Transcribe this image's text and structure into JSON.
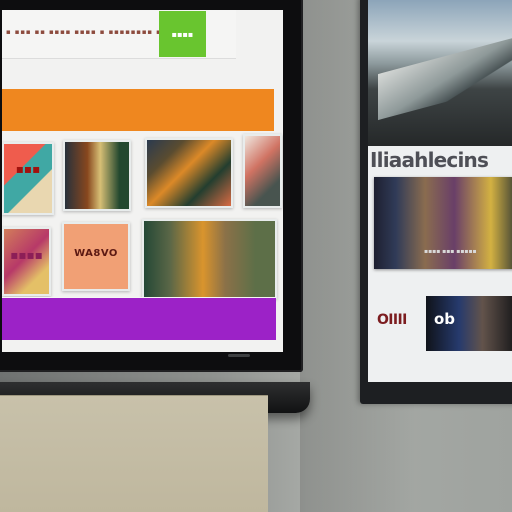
{
  "scene": {
    "main_tv": {
      "search_text": "▪ ▪▪▪ ▪▪ ▪▪▪▪ ▪▪▪▪ ▪ ▪▪▪▪▪▪▪▪ ▪▪",
      "search_button": "▪▪▪▪",
      "tile_labels": [
        "▪▪▪",
        "▪▪▪▪",
        "WA8VO"
      ],
      "small_text": "▪▪▪▪ ▪▪▪"
    },
    "side_tv": {
      "title": "Iliaahlecins",
      "caption": "▪▪▪▪ ▪▪▪ ▪▪▪▪▪",
      "logo": "OIIII",
      "thumb_label": "ob"
    }
  }
}
